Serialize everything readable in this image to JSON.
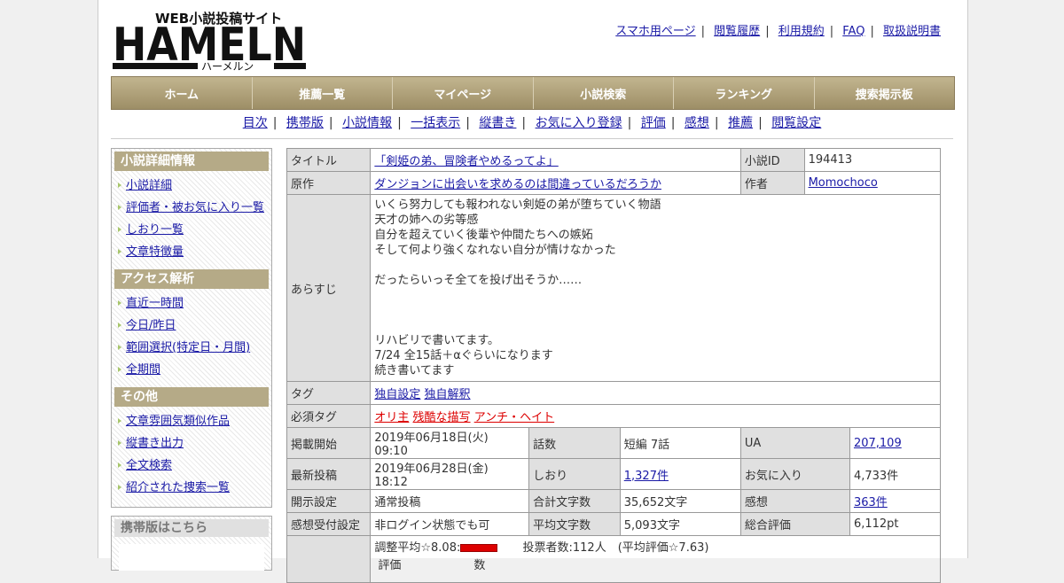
{
  "logo": {
    "sub_jp": "WEB小説投稿サイト",
    "main": "HAMELN",
    "kana": "ハーメルン"
  },
  "top_links": [
    "スマホ用ページ",
    "閲覧履歴",
    "利用規約",
    "FAQ",
    "取扱説明書"
  ],
  "main_nav": [
    "ホーム",
    "推薦一覧",
    "マイページ",
    "小説検索",
    "ランキング",
    "捜索掲示板"
  ],
  "sub_nav": [
    "目次",
    "携帯版",
    "小説情報",
    "一括表示",
    "縦書き",
    "お気に入り登録",
    "評価",
    "感想",
    "推薦",
    "閲覧設定"
  ],
  "sidebar": {
    "sections": [
      {
        "title": "小説詳細情報",
        "items": [
          "小説詳細",
          "評価者・被お気に入り一覧",
          "しおり一覧",
          "文章特徴量"
        ]
      },
      {
        "title": "アクセス解析",
        "items": [
          "直近一時間",
          "今日/昨日",
          "範囲選択(特定日・月間)",
          "全期間"
        ]
      },
      {
        "title": "その他",
        "items": [
          "文章雰囲気類似作品",
          "縦書き出力",
          "全文検索",
          "紹介された捜索一覧"
        ]
      }
    ],
    "mobile_title": "携帯版はこちら"
  },
  "info": {
    "title_label": "タイトル",
    "title": "「剣姫の弟、冒険者やめるってよ」",
    "id_label": "小説ID",
    "id": "194413",
    "original_label": "原作",
    "original": "ダンジョンに出会いを求めるのは間違っているだろうか",
    "author_label": "作者",
    "author": "Momochoco",
    "synopsis_label": "あらすじ",
    "synopsis": [
      "いくら努力しても報われない剣姫の弟が堕ちていく物語",
      "天才の姉への劣等感",
      "自分を超えていく後輩や仲間たちへの嫉妬",
      "そして何より強くなれない自分が情けなかった",
      "",
      "だったらいっそ全てを投げ出そうか……",
      "",
      "",
      "",
      "リハビリで書いてます。",
      "7/24 全15話＋αぐらいになります",
      "続き書いてます"
    ],
    "tag_label": "タグ",
    "tags": [
      "独自設定",
      "独自解釈"
    ],
    "req_tag_label": "必須タグ",
    "req_tags": [
      "オリ主",
      "残酷な描写",
      "アンチ・ヘイト"
    ],
    "rows": [
      [
        {
          "l": "掲載開始",
          "v": "2019年06月18日(火) 09:10"
        },
        {
          "l": "話数",
          "v": "短編 7話"
        },
        {
          "l": "UA",
          "v": "207,109",
          "link": true
        }
      ],
      [
        {
          "l": "最新投稿",
          "v": "2019年06月28日(金) 18:12"
        },
        {
          "l": "しおり",
          "v": "1,327件",
          "link": true
        },
        {
          "l": "お気に入り",
          "v": "4,733件"
        }
      ],
      [
        {
          "l": "開示設定",
          "v": "通常投稿"
        },
        {
          "l": "合計文字数",
          "v": "35,652文字"
        },
        {
          "l": "感想",
          "v": "363件",
          "link": true
        }
      ],
      [
        {
          "l": "感想受付設定",
          "v": "非ログイン状態でも可"
        },
        {
          "l": "平均文字数",
          "v": "5,093文字"
        },
        {
          "l": "総合評価",
          "v": "6,112pt"
        }
      ]
    ],
    "rating_text": "調整平均☆8.08:",
    "rating_fraction": 0.808,
    "voters_text": "投票者数:112人　(平均評価☆7.63)",
    "rating_label": "評価",
    "count_label": "数"
  }
}
